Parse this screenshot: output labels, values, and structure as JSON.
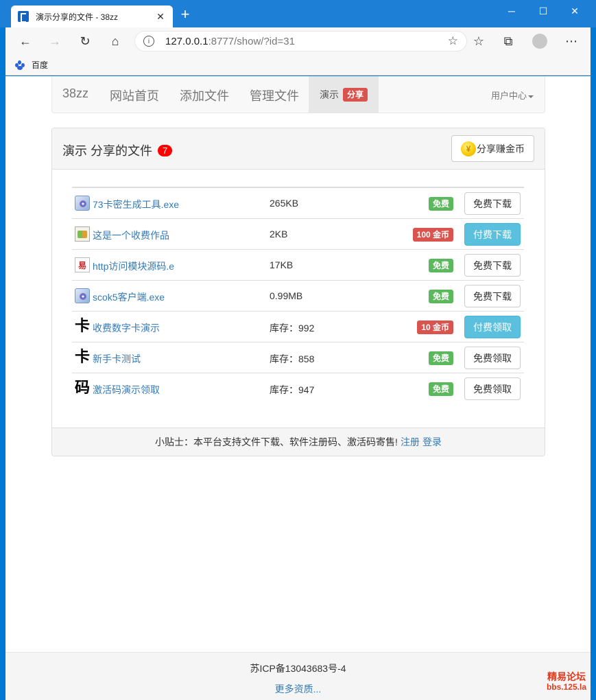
{
  "browser": {
    "tab_title": "演示分享的文件 - 38zz",
    "address_host": "127.0.0.1",
    "address_path": ":8777/show/?id=31",
    "bookmark": "百度"
  },
  "navbar": {
    "brand": "38zz",
    "links": [
      "网站首页",
      "添加文件",
      "管理文件"
    ],
    "active_text": "演示",
    "active_label": "分享",
    "user_menu": "用户中心"
  },
  "panel": {
    "title": "演示 分享的文件",
    "count": "7",
    "share_button": "分享赚金币",
    "coin_symbol": "¥",
    "rows": [
      {
        "icon": "exe-icon",
        "name": "73卡密生成工具.exe",
        "size": "265KB",
        "price": "免费",
        "price_type": "success",
        "action": "免费下载",
        "action_type": "default"
      },
      {
        "icon": "image-icon",
        "name": "这是一个收费作品",
        "size": "2KB",
        "price": "100 金币",
        "price_type": "danger",
        "action": "付费下载",
        "action_type": "info"
      },
      {
        "icon": "e-file-icon",
        "name": "http访问模块源码.e",
        "size": "17KB",
        "price": "免费",
        "price_type": "success",
        "action": "免费下载",
        "action_type": "default"
      },
      {
        "icon": "exe-icon",
        "name": "scok5客户端.exe",
        "size": "0.99MB",
        "price": "免费",
        "price_type": "success",
        "action": "免费下载",
        "action_type": "default"
      },
      {
        "icon": "card-icon",
        "glyph": "卡",
        "name": "收费数字卡演示",
        "size": "库存：992",
        "price": "10 金币",
        "price_type": "danger",
        "action": "付费领取",
        "action_type": "info"
      },
      {
        "icon": "card-icon",
        "glyph": "卡",
        "name": "新手卡测试",
        "size": "库存：858",
        "price": "免费",
        "price_type": "success",
        "action": "免费领取",
        "action_type": "default"
      },
      {
        "icon": "code-icon",
        "glyph": "码",
        "name": "激活码演示领取",
        "size": "库存：947",
        "price": "免费",
        "price_type": "success",
        "action": "免费领取",
        "action_type": "default"
      }
    ],
    "tip": "小贴士：本平台支持文件下载、软件注册码、激活码寄售!",
    "register": "注册",
    "login": "登录"
  },
  "footer": {
    "icp": "苏ICP备13043683号-4",
    "more": "更多资质...",
    "watermark_1": "精易论坛",
    "watermark_2": "bbs.125.la"
  }
}
